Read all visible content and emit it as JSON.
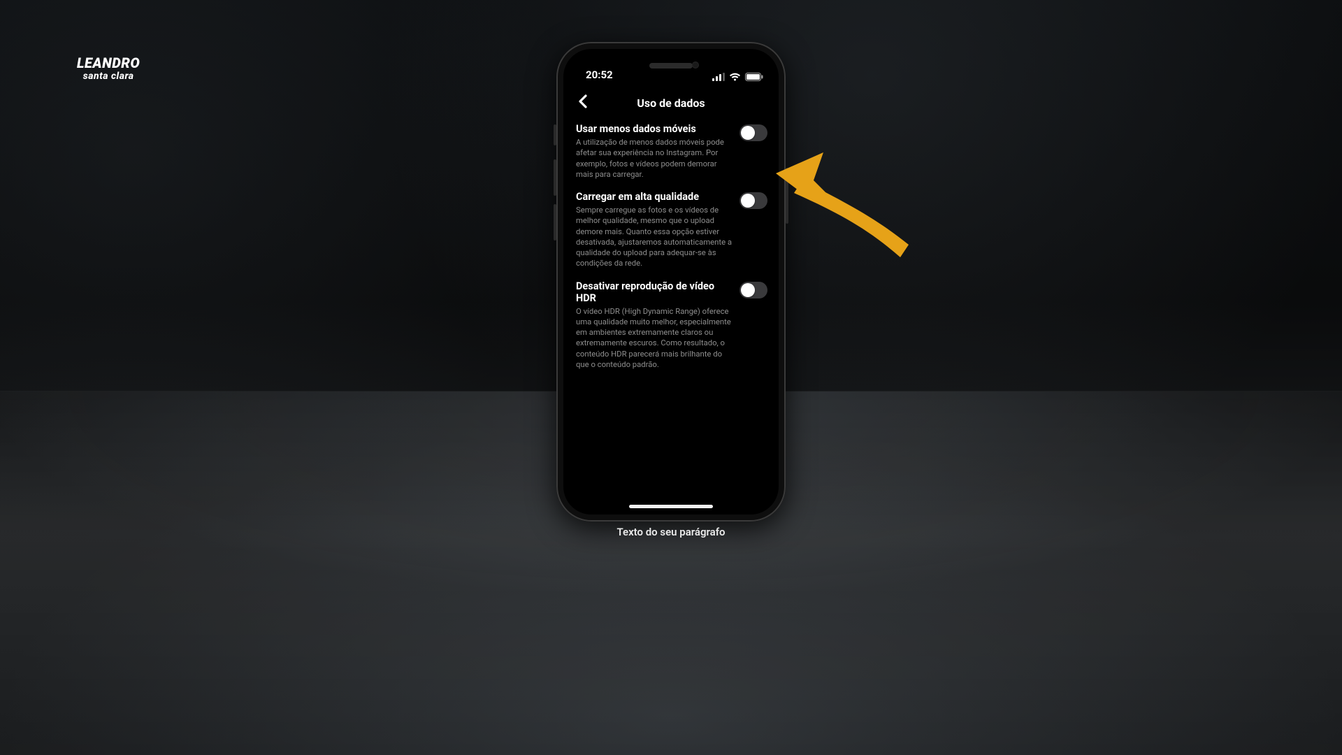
{
  "brand": {
    "line1": "LEANDRO",
    "line2": "santa clara"
  },
  "caption": "Texto do seu parágrafo",
  "statusbar": {
    "time": "20:52"
  },
  "header": {
    "title": "Uso de dados"
  },
  "settings": [
    {
      "title": "Usar menos dados móveis",
      "desc": "A utilização de menos dados móveis pode afetar sua experiência no Instagram. Por exemplo, fotos e vídeos podem demorar mais para carregar."
    },
    {
      "title": "Carregar em alta qualidade",
      "desc": "Sempre carregue as fotos e os vídeos de melhor qualidade, mesmo que o upload demore mais. Quanto essa opção estiver desativada, ajustaremos automaticamente a qualidade do upload para adequar-se às condições da rede."
    },
    {
      "title": "Desativar reprodução de vídeo HDR",
      "desc": "O vídeo HDR (High Dynamic Range) oferece uma qualidade muito melhor, especialmente em ambientes extremamente claros ou extremamente escuros. Como resultado, o conteúdo HDR parecerá mais brilhante do que o conteúdo padrão."
    }
  ]
}
